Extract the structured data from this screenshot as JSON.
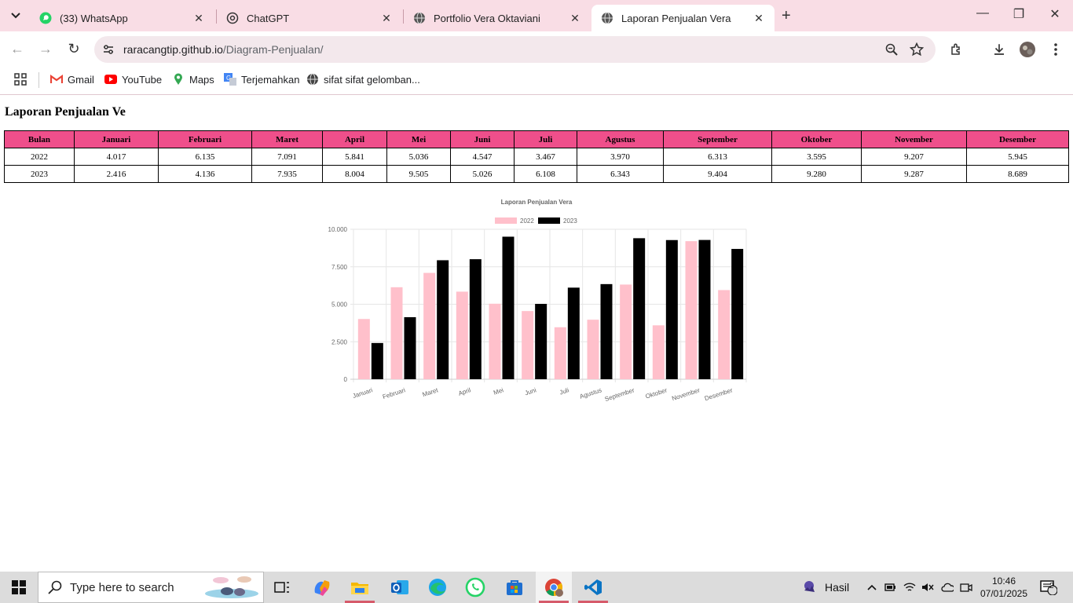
{
  "tabs": [
    {
      "title": "(33) WhatsApp"
    },
    {
      "title": "ChatGPT"
    },
    {
      "title": "Portfolio Vera Oktaviani"
    },
    {
      "title": "Laporan Penjualan Vera"
    }
  ],
  "address": {
    "host": "raracangtip.github.io",
    "path": "/Diagram-Penjualan/"
  },
  "bookmarks": [
    "Gmail",
    "YouTube",
    "Maps",
    "Terjemahkan",
    "sifat sifat gelomban..."
  ],
  "page": {
    "heading": "Laporan Penjualan Ve",
    "table": {
      "headers": [
        "Bulan",
        "Januari",
        "Februari",
        "Maret",
        "April",
        "Mei",
        "Juni",
        "Juli",
        "Agustus",
        "September",
        "Oktober",
        "November",
        "Desember"
      ],
      "rows": [
        [
          "2022",
          "4.017",
          "6.135",
          "7.091",
          "5.841",
          "5.036",
          "4.547",
          "3.467",
          "3.970",
          "6.313",
          "3.595",
          "9.207",
          "5.945"
        ],
        [
          "2023",
          "2.416",
          "4.136",
          "7.935",
          "8.004",
          "9.505",
          "5.026",
          "6.108",
          "6.343",
          "9.404",
          "9.280",
          "9.287",
          "8.689"
        ]
      ]
    }
  },
  "chart_data": {
    "type": "bar",
    "title": "Laporan Penjualan Vera",
    "categories": [
      "Januari",
      "Februari",
      "Maret",
      "April",
      "Mei",
      "Juni",
      "Juli",
      "Agustus",
      "September",
      "Oktober",
      "November",
      "Desember"
    ],
    "series": [
      {
        "name": "2022",
        "color": "#ffc0cb",
        "values": [
          4017,
          6135,
          7091,
          5841,
          5036,
          4547,
          3467,
          3970,
          6313,
          3595,
          9207,
          5945
        ]
      },
      {
        "name": "2023",
        "color": "#000000",
        "values": [
          2416,
          4136,
          7935,
          8004,
          9505,
          5026,
          6108,
          6343,
          9404,
          9280,
          9287,
          8689
        ]
      }
    ],
    "ylim": [
      0,
      10000
    ],
    "yticks": [
      "0",
      "2.500",
      "5.000",
      "7.500",
      "10.000"
    ],
    "grid": true,
    "legend": "top"
  },
  "taskbar": {
    "search_placeholder": "Type here to search",
    "weather": "Hasil",
    "time": "10:46",
    "date": "07/01/2025",
    "notifications": "2"
  }
}
